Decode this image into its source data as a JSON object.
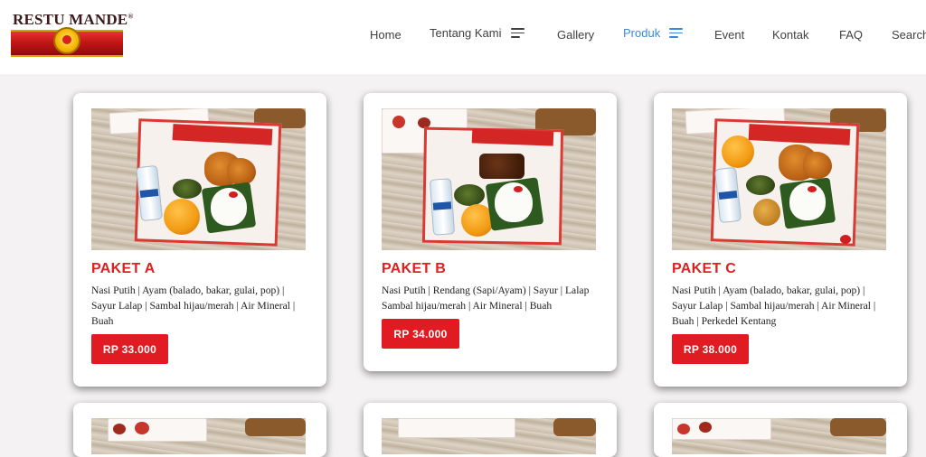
{
  "brand": {
    "name": "RESTU MANDE",
    "mark": "®"
  },
  "nav": {
    "home": "Home",
    "tentang": "Tentang Kami",
    "gallery": "Gallery",
    "produk": "Produk",
    "event": "Event",
    "kontak": "Kontak",
    "faq": "FAQ",
    "search": "Search",
    "active": "Produk",
    "active_color": "#3c8ad6"
  },
  "products": [
    {
      "title": "PAKET A",
      "desc": "Nasi Putih | Ayam (balado, bakar, gulai, pop) | Sayur Lalap | Sambal hijau/merah | Air Mineral | Buah",
      "price": "RP 33.000"
    },
    {
      "title": "PAKET B",
      "desc": "Nasi Putih | Rendang (Sapi/Ayam) | Sayur | Lalap Sambal hijau/merah | Air Mineral | Buah",
      "price": "RP 34.000"
    },
    {
      "title": "PAKET C",
      "desc": "Nasi Putih | Ayam (balado, bakar, gulai, pop) | Sayur Lalap | Sambal hijau/merah | Air Mineral | Buah | Perkedel Kentang",
      "price": "RP 38.000"
    }
  ],
  "colors": {
    "accent_red": "#e01b22",
    "title_red": "#e02020",
    "page_bg": "#f4f2f2"
  }
}
